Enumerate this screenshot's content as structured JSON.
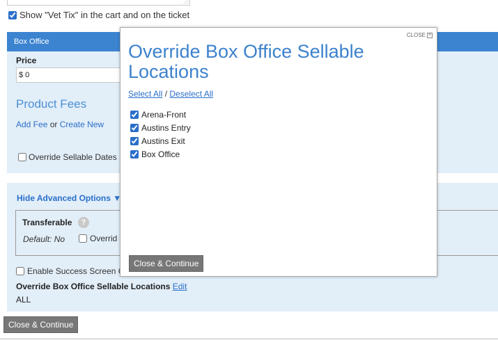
{
  "vet_tix": {
    "checked": true,
    "label": "Show \"Vet Tix\" in the cart and on the ticket"
  },
  "box_office": {
    "header": "Box Office",
    "price_label": "Price",
    "price_value": "$ 0",
    "fees_heading": "Product Fees",
    "add_fee": "Add Fee",
    "or_text": "or",
    "create_new": "Create New",
    "override_dates": "Override Sellable Dates"
  },
  "advanced": {
    "toggle_label": "Hide Advanced Options ▼",
    "transferable_title": "Transferable",
    "help_glyph": "?",
    "default_text": "Default: No",
    "override_label": "Overrid",
    "success_label": "Enable Success Screen C",
    "locations_title": "Override Box Office Sellable Locations",
    "edit_link": "Edit",
    "locations_value": "ALL"
  },
  "continue_button": "Close & Continue",
  "modal": {
    "close_label": "CLOSE",
    "close_icon": "close-icon",
    "title": "Override Box Office Sellable Locations",
    "select_all": "Select All",
    "separator": "/",
    "deselect_all": "Deselect All",
    "locations": [
      {
        "label": "Arena-Front",
        "checked": true
      },
      {
        "label": "Austins Entry",
        "checked": true
      },
      {
        "label": "Austins Exit",
        "checked": true
      },
      {
        "label": "Box Office",
        "checked": true
      }
    ],
    "continue_button": "Close & Continue"
  },
  "colors": {
    "accent": "#3c84d0",
    "panel_bg": "#e2eef8",
    "link": "#2a6fc9",
    "button_bg": "#777777"
  }
}
